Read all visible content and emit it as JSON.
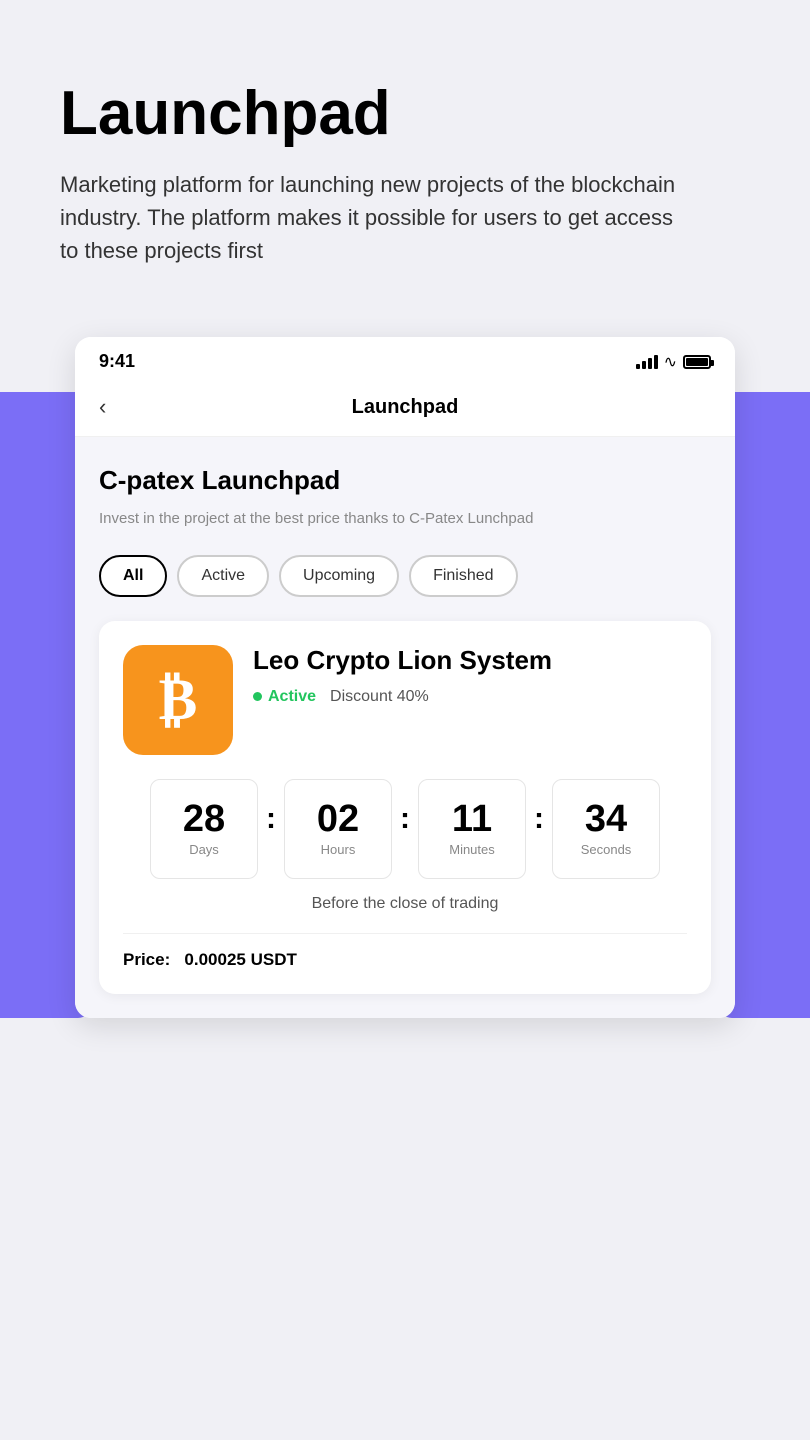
{
  "hero": {
    "title": "Launchpad",
    "description": "Marketing platform for launching new projects of the blockchain industry. The platform makes it possible for users to get access to these projects first"
  },
  "statusBar": {
    "time": "9:41"
  },
  "nav": {
    "title": "Launchpad",
    "back_label": "‹"
  },
  "section": {
    "title": "C-patex Launchpad",
    "description": "Invest in the project at the best price thanks to C-Patex Lunchpad"
  },
  "filters": [
    {
      "label": "All",
      "active": true
    },
    {
      "label": "Active",
      "active": false
    },
    {
      "label": "Upcoming",
      "active": false
    },
    {
      "label": "Finished",
      "active": false
    }
  ],
  "project": {
    "name": "Leo Crypto Lion System",
    "status": "Active",
    "discount": "Discount 40%",
    "countdown": {
      "days": {
        "value": "28",
        "label": "Days"
      },
      "hours": {
        "value": "02",
        "label": "Hours"
      },
      "minutes": {
        "value": "11",
        "label": "Minutes"
      },
      "seconds": {
        "value": "34",
        "label": "Seconds"
      }
    },
    "countdown_text": "Before the close of trading",
    "price_label": "Price:",
    "price_value": "0.00025 USDT"
  }
}
